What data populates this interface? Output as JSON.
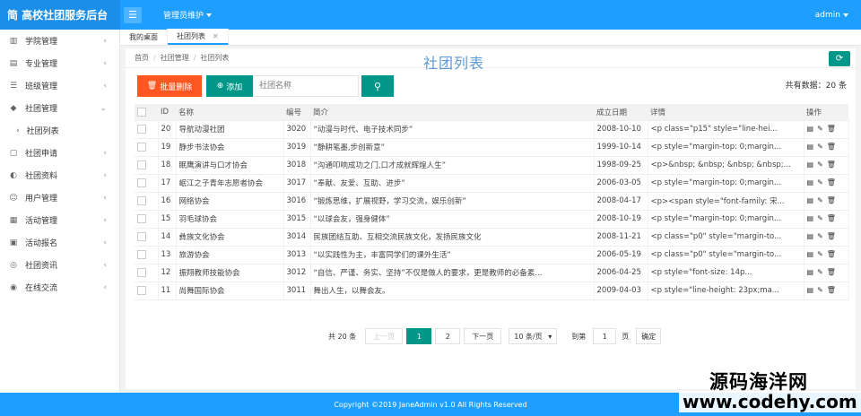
{
  "header": {
    "brand": "简 高校社团服务后台",
    "menu_toggle": "☰",
    "admin_menu": "管理员维护",
    "user": "admin"
  },
  "sidebar": {
    "items": [
      {
        "label": "学院管理",
        "icon": "building-icon"
      },
      {
        "label": "专业管理",
        "icon": "list-icon"
      },
      {
        "label": "班级管理",
        "icon": "sliders-icon"
      },
      {
        "label": "社团管理",
        "icon": "graduation-cap-icon",
        "expanded": true
      },
      {
        "label": "社团申请",
        "icon": "document-icon"
      },
      {
        "label": "社团资料",
        "icon": "chat-icon"
      },
      {
        "label": "用户管理",
        "icon": "user-icon"
      },
      {
        "label": "活动管理",
        "icon": "grid-icon"
      },
      {
        "label": "活动报名",
        "icon": "calendar-icon"
      },
      {
        "label": "社团资讯",
        "icon": "globe-icon"
      },
      {
        "label": "在线交流",
        "icon": "compass-icon"
      }
    ],
    "sub_item": "社团列表"
  },
  "tabs": [
    {
      "label": "我的桌面"
    },
    {
      "label": "社团列表",
      "active": true
    }
  ],
  "breadcrumb": {
    "home": "首页",
    "level1": "社团管理",
    "level2": "社团列表"
  },
  "page_title": "社团列表",
  "toolbar": {
    "batch_delete": "批量删除",
    "add": "添加",
    "search_placeholder": "社团名称",
    "total": "共有数据：20 条"
  },
  "table": {
    "headers": [
      "ID",
      "名称",
      "编号",
      "简介",
      "成立日期",
      "详情",
      "操作"
    ],
    "rows": [
      {
        "id": "20",
        "name": "导航动漫社团",
        "code": "3020",
        "intro": "“动漫与时代、电子技术同步”",
        "date": "2008-10-10",
        "detail": "<p class=\"p15\" style=\"line-hei..."
      },
      {
        "id": "19",
        "name": "静步书法协会",
        "code": "3019",
        "intro": "“静耕笔墨,步创新意”",
        "date": "1999-10-14",
        "detail": "<p style=\"margin-top: 0;margin..."
      },
      {
        "id": "18",
        "name": "眠鹰演讲与口才协会",
        "code": "3018",
        "intro": "“沟通叩响成功之门,口才成就辉煌人生”",
        "date": "1998-09-25",
        "detail": "<p>&nbsp; &nbsp; &nbsp; &nbsp;..."
      },
      {
        "id": "17",
        "name": "岷江之子青年志愿者协会",
        "code": "3017",
        "intro": "“奉献、友爱、互助、进步”",
        "date": "2006-03-05",
        "detail": "<p style=\"margin-top: 0;margin..."
      },
      {
        "id": "16",
        "name": "网络协会",
        "code": "3016",
        "intro": "“锻炼思维，扩展视野，学习交流，娱乐创新”",
        "date": "2008-04-17",
        "detail": "<p><span style=\"font-family: 宋..."
      },
      {
        "id": "15",
        "name": "羽毛球协会",
        "code": "3015",
        "intro": "“以球会友，强身健体”",
        "date": "2008-10-19",
        "detail": "<p style=\"margin-top: 0;margin..."
      },
      {
        "id": "14",
        "name": "彝族文化协会",
        "code": "3014",
        "intro": "民族团结互助、互相交流民族文化，发扬民族文化",
        "date": "2008-11-21",
        "detail": "<p class=\"p0\" style=\"margin-to..."
      },
      {
        "id": "13",
        "name": "旅游协会",
        "code": "3013",
        "intro": "“以实践性为主，丰富同学们的课外生活”",
        "date": "2006-05-19",
        "detail": "<p class=\"p0\" style=\"margin-to..."
      },
      {
        "id": "12",
        "name": "振翔教师技能协会",
        "code": "3012",
        "intro": "“自信、严谨、务实、坚持”不仅是做人的要求，更是教师的必备素...",
        "date": "2006-04-25",
        "detail": "<p style=\"font-size: 14p..."
      },
      {
        "id": "11",
        "name": "尚舞国际协会",
        "code": "3011",
        "intro": "舞出人生，以舞会友。",
        "date": "2009-04-03",
        "detail": "<p style=\"line-height: 23px;ma..."
      }
    ]
  },
  "pagination": {
    "total": "共 20 条",
    "prev": "上一页",
    "page1": "1",
    "page2": "2",
    "next": "下一页",
    "per_page": "10 条/页",
    "goto": "到第",
    "goto_value": "1",
    "page_unit": "页",
    "confirm": "确定"
  },
  "footer": "Copyright ©2019 JaneAdmin v1.0 All Rights Reserved",
  "watermark": {
    "line1": "源码海洋网",
    "line2": "www.codehy.com"
  }
}
